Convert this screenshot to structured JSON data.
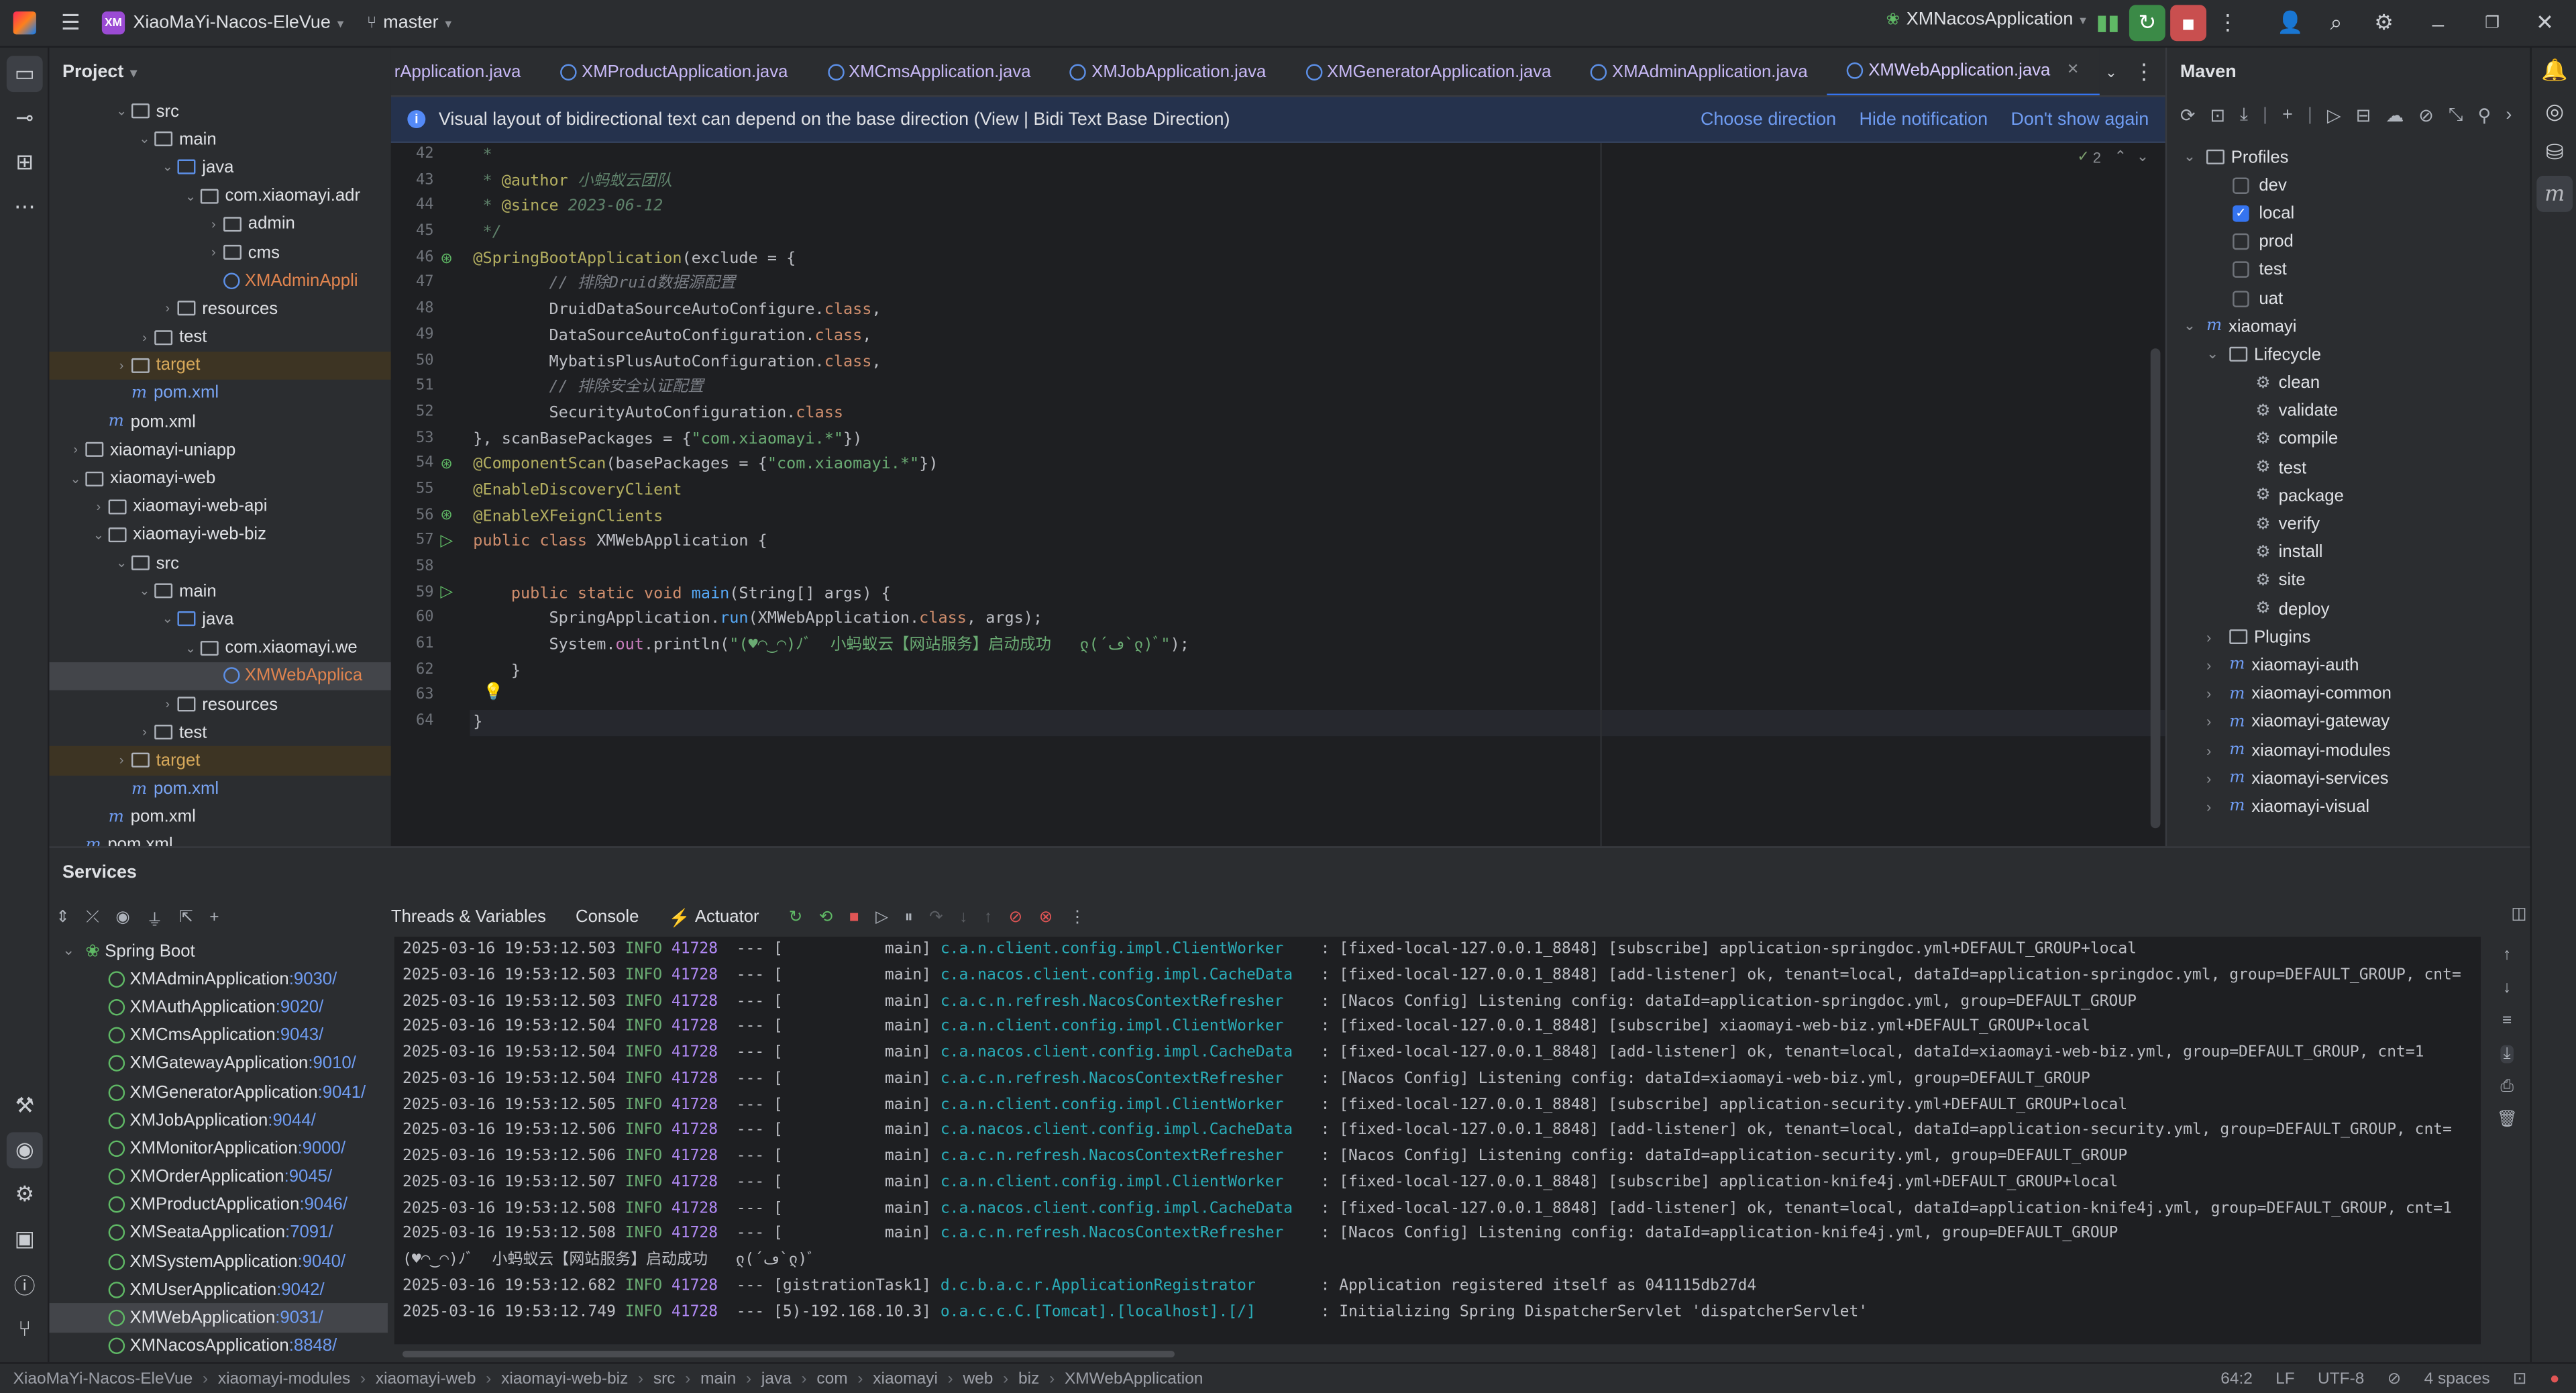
{
  "titlebar": {
    "project_badge": "XM",
    "project_name": "XiaoMaYi-Nacos-EleVue",
    "branch": "master",
    "run_config": "XMNacosApplication"
  },
  "project_panel": {
    "title": "Project",
    "rows": [
      {
        "indent": 4,
        "arrow": "v",
        "icon": "folder",
        "label": "src"
      },
      {
        "indent": 5,
        "arrow": "v",
        "icon": "folder",
        "label": "main"
      },
      {
        "indent": 6,
        "arrow": "v",
        "icon": "folder-blue",
        "label": "java"
      },
      {
        "indent": 7,
        "arrow": "v",
        "icon": "folder",
        "label": "com.xiaomayi.adr"
      },
      {
        "indent": 8,
        "arrow": ">",
        "icon": "folder",
        "label": "admin"
      },
      {
        "indent": 8,
        "arrow": ">",
        "icon": "folder",
        "label": "cms"
      },
      {
        "indent": 8,
        "arrow": "",
        "icon": "java",
        "label": "XMAdminAppli",
        "style": "orange"
      },
      {
        "indent": 6,
        "arrow": ">",
        "icon": "folder",
        "label": "resources"
      },
      {
        "indent": 5,
        "arrow": ">",
        "icon": "folder",
        "label": "test"
      },
      {
        "indent": 4,
        "arrow": ">",
        "icon": "folder",
        "label": "target",
        "style": "target"
      },
      {
        "indent": 4,
        "arrow": "",
        "icon": "maven",
        "label": "pom.xml",
        "style": "blue"
      },
      {
        "indent": 3,
        "arrow": "",
        "icon": "maven",
        "label": "pom.xml"
      },
      {
        "indent": 2,
        "arrow": ">",
        "icon": "folder",
        "label": "xiaomayi-uniapp"
      },
      {
        "indent": 2,
        "arrow": "v",
        "icon": "folder",
        "label": "xiaomayi-web"
      },
      {
        "indent": 3,
        "arrow": ">",
        "icon": "folder",
        "label": "xiaomayi-web-api"
      },
      {
        "indent": 3,
        "arrow": "v",
        "icon": "folder",
        "label": "xiaomayi-web-biz"
      },
      {
        "indent": 4,
        "arrow": "v",
        "icon": "folder",
        "label": "src"
      },
      {
        "indent": 5,
        "arrow": "v",
        "icon": "folder",
        "label": "main"
      },
      {
        "indent": 6,
        "arrow": "v",
        "icon": "folder-blue",
        "label": "java"
      },
      {
        "indent": 7,
        "arrow": "v",
        "icon": "folder",
        "label": "com.xiaomayi.we"
      },
      {
        "indent": 8,
        "arrow": "",
        "icon": "java",
        "label": "XMWebApplica",
        "style": "orange-sel"
      },
      {
        "indent": 6,
        "arrow": ">",
        "icon": "folder",
        "label": "resources"
      },
      {
        "indent": 5,
        "arrow": ">",
        "icon": "folder",
        "label": "test"
      },
      {
        "indent": 4,
        "arrow": ">",
        "icon": "folder",
        "label": "target",
        "style": "target"
      },
      {
        "indent": 4,
        "arrow": "",
        "icon": "maven",
        "label": "pom.xml",
        "style": "blue"
      },
      {
        "indent": 3,
        "arrow": "",
        "icon": "maven",
        "label": "pom.xml"
      },
      {
        "indent": 2,
        "arrow": "",
        "icon": "maven",
        "label": "pom.xml"
      }
    ]
  },
  "tabs": [
    {
      "label": "rApplication.java",
      "active": false
    },
    {
      "label": "XMProductApplication.java",
      "active": false
    },
    {
      "label": "XMCmsApplication.java",
      "active": false
    },
    {
      "label": "XMJobApplication.java",
      "active": false
    },
    {
      "label": "XMGeneratorApplication.java",
      "active": false
    },
    {
      "label": "XMAdminApplication.java",
      "active": false
    },
    {
      "label": "XMWebApplication.java",
      "active": true
    }
  ],
  "notification": {
    "message": "Visual layout of bidirectional text can depend on the base direction (View | Bidi Text Base Direction)",
    "choose": "Choose direction",
    "hide": "Hide notification",
    "dont_show": "Don't show again"
  },
  "editor": {
    "line_numbers": [
      "42",
      "43",
      "44",
      "45",
      "46",
      "47",
      "48",
      "49",
      "50",
      "51",
      "52",
      "53",
      "54",
      "55",
      "56",
      "57",
      "58",
      "59",
      "60",
      "61",
      "62",
      "63",
      "64"
    ],
    "warning_count": "2",
    "lines": [
      [
        {
          "c": "doc",
          "t": " *"
        }
      ],
      [
        {
          "c": "doc",
          "t": " * "
        },
        {
          "c": "ann",
          "t": "@author"
        },
        {
          "c": "doc",
          "t": " 小蚂蚁云团队"
        }
      ],
      [
        {
          "c": "doc",
          "t": " * "
        },
        {
          "c": "ann",
          "t": "@since"
        },
        {
          "c": "doc",
          "t": " 2023-06-12"
        }
      ],
      [
        {
          "c": "doc",
          "t": " */"
        }
      ],
      [
        {
          "c": "ann",
          "t": "@SpringBootApplication"
        },
        {
          "c": "",
          "t": "(exclude = {"
        }
      ],
      [
        {
          "c": "cmt",
          "t": "        // 排除Druid数据源配置"
        }
      ],
      [
        {
          "c": "",
          "t": "        DruidDataSourceAutoConfigure."
        },
        {
          "c": "kw",
          "t": "class"
        },
        {
          "c": "",
          "t": ","
        }
      ],
      [
        {
          "c": "",
          "t": "        DataSourceAutoConfiguration."
        },
        {
          "c": "kw",
          "t": "class"
        },
        {
          "c": "",
          "t": ","
        }
      ],
      [
        {
          "c": "",
          "t": "        MybatisPlusAutoConfiguration."
        },
        {
          "c": "kw",
          "t": "class"
        },
        {
          "c": "",
          "t": ","
        }
      ],
      [
        {
          "c": "cmt",
          "t": "        // 排除安全认证配置"
        }
      ],
      [
        {
          "c": "",
          "t": "        SecurityAutoConfiguration."
        },
        {
          "c": "kw",
          "t": "class"
        }
      ],
      [
        {
          "c": "",
          "t": "}, scanBasePackages = {"
        },
        {
          "c": "str",
          "t": "\"com.xiaomayi.*\""
        },
        {
          "c": "",
          "t": "})"
        }
      ],
      [
        {
          "c": "ann",
          "t": "@ComponentScan"
        },
        {
          "c": "",
          "t": "(basePackages = {"
        },
        {
          "c": "str",
          "t": "\"com.xiaomayi.*\""
        },
        {
          "c": "",
          "t": "})"
        }
      ],
      [
        {
          "c": "ann",
          "t": "@EnableDiscoveryClient"
        }
      ],
      [
        {
          "c": "ann",
          "t": "@EnableXFeignClients"
        }
      ],
      [
        {
          "c": "kw",
          "t": "public class "
        },
        {
          "c": "",
          "t": "XMWebApplication {"
        }
      ],
      [
        {
          "c": "",
          "t": ""
        }
      ],
      [
        {
          "c": "kw",
          "t": "    public static void "
        },
        {
          "c": "method",
          "t": "main"
        },
        {
          "c": "",
          "t": "(String[] args) {"
        }
      ],
      [
        {
          "c": "",
          "t": "        SpringApplication."
        },
        {
          "c": "method",
          "t": "run"
        },
        {
          "c": "",
          "t": "(XMWebApplication."
        },
        {
          "c": "kw",
          "t": "class"
        },
        {
          "c": "",
          "t": ", args);"
        }
      ],
      [
        {
          "c": "",
          "t": "        System."
        },
        {
          "c": "fld",
          "t": "out"
        },
        {
          "c": "",
          "t": ".println("
        },
        {
          "c": "str",
          "t": "\"(♥◠‿◠)ﾉﾞ  小蚂蚁云【网站服务】启动成功   ლ(´ڡ`ლ)ﾞ\""
        },
        {
          "c": "",
          "t": ");"
        }
      ],
      [
        {
          "c": "",
          "t": "    }"
        }
      ],
      [
        {
          "c": "",
          "t": ""
        }
      ],
      [
        {
          "c": "",
          "t": "}"
        }
      ]
    ]
  },
  "maven": {
    "title": "Maven",
    "rows": [
      {
        "indent": 0,
        "arrow": "v",
        "kind": "folder",
        "label": "Profiles"
      },
      {
        "indent": 1,
        "kind": "cb",
        "checked": false,
        "label": "dev"
      },
      {
        "indent": 1,
        "kind": "cb",
        "checked": true,
        "label": "local"
      },
      {
        "indent": 1,
        "kind": "cb",
        "checked": false,
        "label": "prod"
      },
      {
        "indent": 1,
        "kind": "cb",
        "checked": false,
        "label": "test"
      },
      {
        "indent": 1,
        "kind": "cb",
        "checked": false,
        "label": "uat"
      },
      {
        "indent": 0,
        "arrow": "v",
        "kind": "maven",
        "label": "xiaomayi"
      },
      {
        "indent": 1,
        "arrow": "v",
        "kind": "folder",
        "label": "Lifecycle"
      },
      {
        "indent": 2,
        "kind": "gear",
        "label": "clean"
      },
      {
        "indent": 2,
        "kind": "gear",
        "label": "validate"
      },
      {
        "indent": 2,
        "kind": "gear",
        "label": "compile"
      },
      {
        "indent": 2,
        "kind": "gear",
        "label": "test"
      },
      {
        "indent": 2,
        "kind": "gear",
        "label": "package"
      },
      {
        "indent": 2,
        "kind": "gear",
        "label": "verify"
      },
      {
        "indent": 2,
        "kind": "gear",
        "label": "install"
      },
      {
        "indent": 2,
        "kind": "gear",
        "label": "site"
      },
      {
        "indent": 2,
        "kind": "gear",
        "label": "deploy"
      },
      {
        "indent": 1,
        "arrow": ">",
        "kind": "folder",
        "label": "Plugins"
      },
      {
        "indent": 1,
        "arrow": ">",
        "kind": "maven",
        "label": "xiaomayi-auth"
      },
      {
        "indent": 1,
        "arrow": ">",
        "kind": "maven",
        "label": "xiaomayi-common"
      },
      {
        "indent": 1,
        "arrow": ">",
        "kind": "maven",
        "label": "xiaomayi-gateway"
      },
      {
        "indent": 1,
        "arrow": ">",
        "kind": "maven",
        "label": "xiaomayi-modules"
      },
      {
        "indent": 1,
        "arrow": ">",
        "kind": "maven",
        "label": "xiaomayi-services"
      },
      {
        "indent": 1,
        "arrow": ">",
        "kind": "maven",
        "label": "xiaomayi-visual"
      }
    ]
  },
  "services": {
    "title": "Services",
    "group": "Spring Boot",
    "apps": [
      {
        "name": "XMAdminApplication",
        "port": ":9030/"
      },
      {
        "name": "XMAuthApplication",
        "port": ":9020/"
      },
      {
        "name": "XMCmsApplication",
        "port": ":9043/"
      },
      {
        "name": "XMGatewayApplication",
        "port": ":9010/"
      },
      {
        "name": "XMGeneratorApplication",
        "port": ":9041/"
      },
      {
        "name": "XMJobApplication",
        "port": ":9044/"
      },
      {
        "name": "XMMonitorApplication",
        "port": ":9000/"
      },
      {
        "name": "XMOrderApplication",
        "port": ":9045/"
      },
      {
        "name": "XMProductApplication",
        "port": ":9046/"
      },
      {
        "name": "XMSeataApplication",
        "port": ":7091/"
      },
      {
        "name": "XMSystemApplication",
        "port": ":9040/"
      },
      {
        "name": "XMUserApplication",
        "port": ":9042/"
      },
      {
        "name": "XMWebApplication",
        "port": ":9031/",
        "selected": true
      },
      {
        "name": "XMNacosApplication",
        "port": ":8848/"
      }
    ],
    "console_tabs": [
      "Threads & Variables",
      "Console",
      "Actuator"
    ],
    "logs": [
      {
        "ts": "2025-03-16 19:53:12.503",
        "lvl": "INFO",
        "pid": "41728",
        "th": " --- [           main]",
        "logger": "c.a.n.client.config.impl.ClientWorker   ",
        "msg": " : [fixed-local-127.0.0.1_8848] [subscribe] application-springdoc.yml+DEFAULT_GROUP+local"
      },
      {
        "ts": "2025-03-16 19:53:12.503",
        "lvl": "INFO",
        "pid": "41728",
        "th": " --- [           main]",
        "logger": "c.a.nacos.client.config.impl.CacheData  ",
        "msg": " : [fixed-local-127.0.0.1_8848] [add-listener] ok, tenant=local, dataId=application-springdoc.yml, group=DEFAULT_GROUP, cnt="
      },
      {
        "ts": "2025-03-16 19:53:12.503",
        "lvl": "INFO",
        "pid": "41728",
        "th": " --- [           main]",
        "logger": "c.a.c.n.refresh.NacosContextRefresher   ",
        "msg": " : [Nacos Config] Listening config: dataId=application-springdoc.yml, group=DEFAULT_GROUP"
      },
      {
        "ts": "2025-03-16 19:53:12.504",
        "lvl": "INFO",
        "pid": "41728",
        "th": " --- [           main]",
        "logger": "c.a.n.client.config.impl.ClientWorker   ",
        "msg": " : [fixed-local-127.0.0.1_8848] [subscribe] xiaomayi-web-biz.yml+DEFAULT_GROUP+local"
      },
      {
        "ts": "2025-03-16 19:53:12.504",
        "lvl": "INFO",
        "pid": "41728",
        "th": " --- [           main]",
        "logger": "c.a.nacos.client.config.impl.CacheData  ",
        "msg": " : [fixed-local-127.0.0.1_8848] [add-listener] ok, tenant=local, dataId=xiaomayi-web-biz.yml, group=DEFAULT_GROUP, cnt=1"
      },
      {
        "ts": "2025-03-16 19:53:12.504",
        "lvl": "INFO",
        "pid": "41728",
        "th": " --- [           main]",
        "logger": "c.a.c.n.refresh.NacosContextRefresher   ",
        "msg": " : [Nacos Config] Listening config: dataId=xiaomayi-web-biz.yml, group=DEFAULT_GROUP"
      },
      {
        "ts": "2025-03-16 19:53:12.505",
        "lvl": "INFO",
        "pid": "41728",
        "th": " --- [           main]",
        "logger": "c.a.n.client.config.impl.ClientWorker   ",
        "msg": " : [fixed-local-127.0.0.1_8848] [subscribe] application-security.yml+DEFAULT_GROUP+local"
      },
      {
        "ts": "2025-03-16 19:53:12.506",
        "lvl": "INFO",
        "pid": "41728",
        "th": " --- [           main]",
        "logger": "c.a.nacos.client.config.impl.CacheData  ",
        "msg": " : [fixed-local-127.0.0.1_8848] [add-listener] ok, tenant=local, dataId=application-security.yml, group=DEFAULT_GROUP, cnt="
      },
      {
        "ts": "2025-03-16 19:53:12.506",
        "lvl": "INFO",
        "pid": "41728",
        "th": " --- [           main]",
        "logger": "c.a.c.n.refresh.NacosContextRefresher   ",
        "msg": " : [Nacos Config] Listening config: dataId=application-security.yml, group=DEFAULT_GROUP"
      },
      {
        "ts": "2025-03-16 19:53:12.507",
        "lvl": "INFO",
        "pid": "41728",
        "th": " --- [           main]",
        "logger": "c.a.n.client.config.impl.ClientWorker   ",
        "msg": " : [fixed-local-127.0.0.1_8848] [subscribe] application-knife4j.yml+DEFAULT_GROUP+local"
      },
      {
        "ts": "2025-03-16 19:53:12.508",
        "lvl": "INFO",
        "pid": "41728",
        "th": " --- [           main]",
        "logger": "c.a.nacos.client.config.impl.CacheData  ",
        "msg": " : [fixed-local-127.0.0.1_8848] [add-listener] ok, tenant=local, dataId=application-knife4j.yml, group=DEFAULT_GROUP, cnt=1"
      },
      {
        "ts": "2025-03-16 19:53:12.508",
        "lvl": "INFO",
        "pid": "41728",
        "th": " --- [           main]",
        "logger": "c.a.c.n.refresh.NacosContextRefresher   ",
        "msg": " : [Nacos Config] Listening config: dataId=application-knife4j.yml, group=DEFAULT_GROUP"
      },
      {
        "plain": "(♥◠‿◠)ﾉﾞ  小蚂蚁云【网站服务】启动成功   ლ(´ڡ`ლ)ﾞ"
      },
      {
        "ts": "2025-03-16 19:53:12.682",
        "lvl": "INFO",
        "pid": "41728",
        "th": " --- [gistrationTask1]",
        "logger": "d.c.b.a.c.r.ApplicationRegistrator      ",
        "msg": " : Application registered itself as 041115db27d4"
      },
      {
        "ts": "2025-03-16 19:53:12.749",
        "lvl": "INFO",
        "pid": "41728",
        "th": " --- [5)-192.168.10.3]",
        "logger": "o.a.c.c.C.[Tomcat].[localhost].[/]      ",
        "msg": " : Initializing Spring DispatcherServlet 'dispatcherServlet'"
      }
    ]
  },
  "statusbar": {
    "crumbs": [
      "XiaoMaYi-Nacos-EleVue",
      "xiaomayi-modules",
      "xiaomayi-web",
      "xiaomayi-web-biz",
      "src",
      "main",
      "java",
      "com",
      "xiaomayi",
      "web",
      "biz",
      "XMWebApplication"
    ],
    "position": "64:2",
    "line_sep": "LF",
    "encoding": "UTF-8",
    "indent": "4 spaces"
  }
}
